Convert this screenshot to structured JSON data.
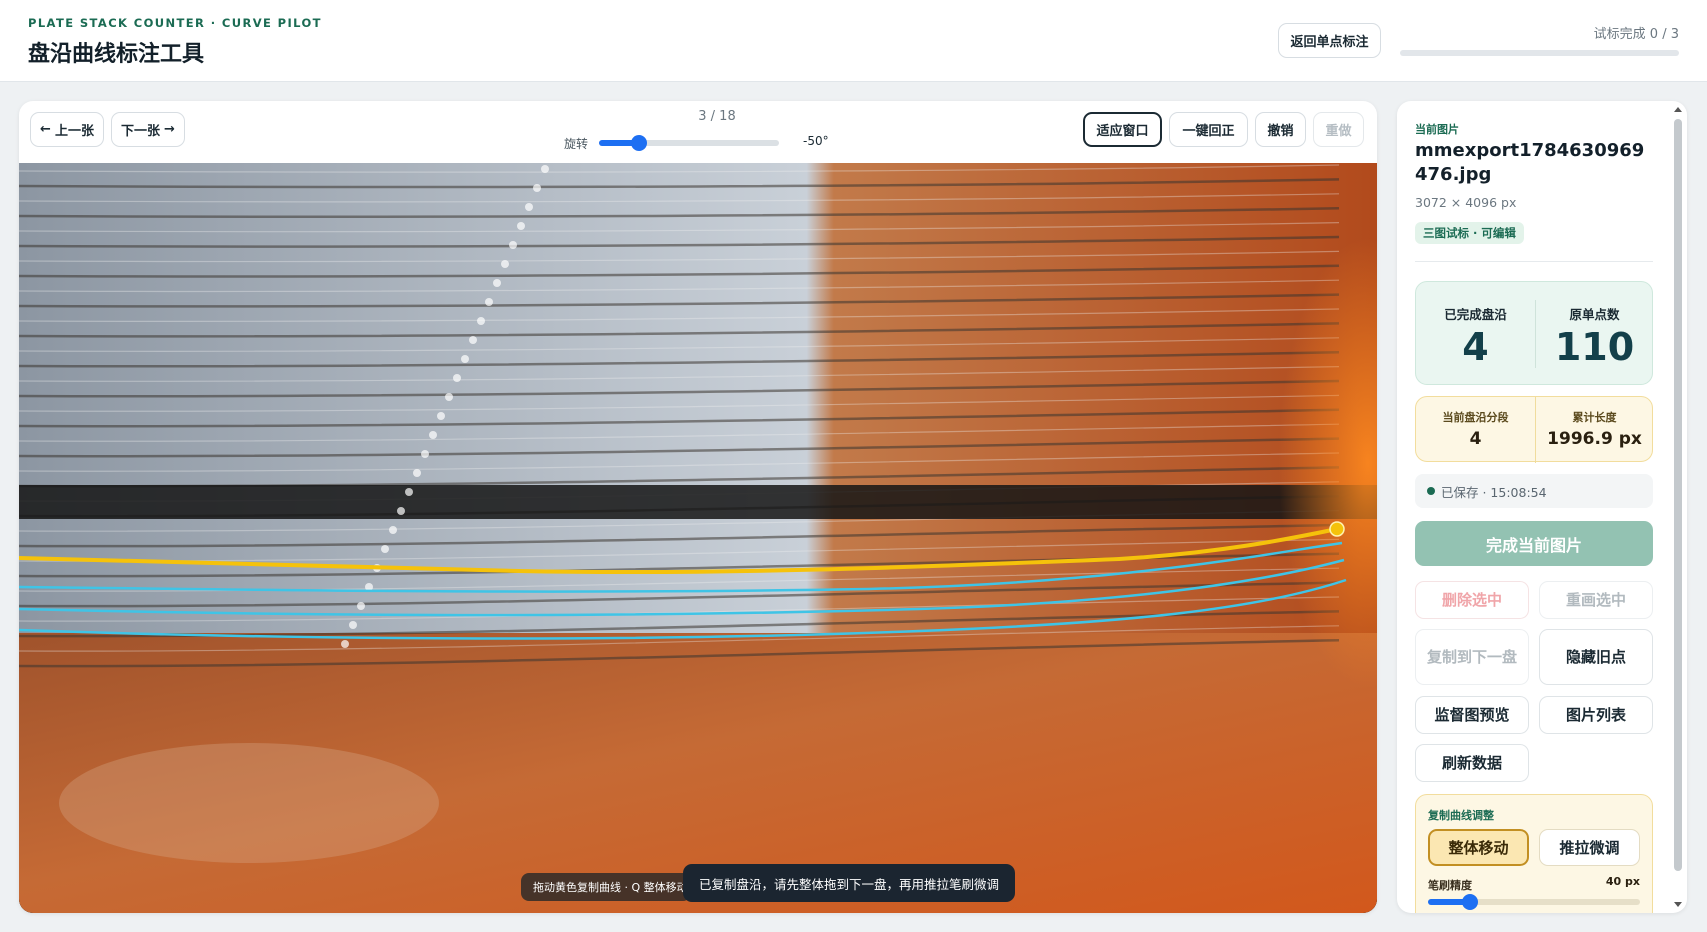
{
  "header": {
    "kicker": "PLATE STACK COUNTER · CURVE PILOT",
    "title": "盘沿曲线标注工具",
    "back_button": "返回单点标注",
    "trial_status": "试标完成 0 / 3",
    "trial_progress": 0
  },
  "toolbar": {
    "prev_label": "上一张",
    "next_label": "下一张",
    "counter": "3 / 18",
    "rotate_label": "旋转",
    "rotate_value": "-50°",
    "rotate_min": -90,
    "rotate_max": 90,
    "rotate_current": -50,
    "fit_label": "适应窗口",
    "reset_label": "一键回正",
    "undo_label": "撤销",
    "redo_label": "重做"
  },
  "canvas": {
    "hint_text": "拖动黄色复制曲线 · Q 整体移动",
    "toast_text": "已复制盘沿，请先整体拖到下一盘，再用推拉笔刷微调",
    "colors": {
      "active_curve": "#f5c20b",
      "done_curve": "#3fc4e6"
    }
  },
  "side": {
    "current_kicker": "当前图片",
    "file_name": "mmexport1784630969476.jpg",
    "file_dim": "3072 × 4096 px",
    "file_badge": "三图试标 · 可编辑",
    "stats": {
      "done_label": "已完成盘沿",
      "done_value": "4",
      "points_label": "原单点数",
      "points_value": "110",
      "segments_label": "当前盘沿分段",
      "segments_value": "4",
      "length_label": "累计长度",
      "length_value": "1996.9 px"
    },
    "saved_text": "已保存 · 15:08:54",
    "finish_button": "完成当前图片",
    "buttons": {
      "delete_selected": "删除选中",
      "redraw_selected": "重画选中",
      "copy_next": "复制到下一盘",
      "hide_old": "隐藏旧点",
      "supervise_preview": "监督图预览",
      "image_list": "图片列表",
      "refresh_data": "刷新数据"
    },
    "adjust": {
      "title": "复制曲线调整",
      "move_all": "整体移动",
      "push_pull": "推拉微调",
      "brush_label": "笔刷精度",
      "brush_value": "40 px",
      "brush_min": 0,
      "brush_max": 200,
      "brush_current": 40
    }
  }
}
